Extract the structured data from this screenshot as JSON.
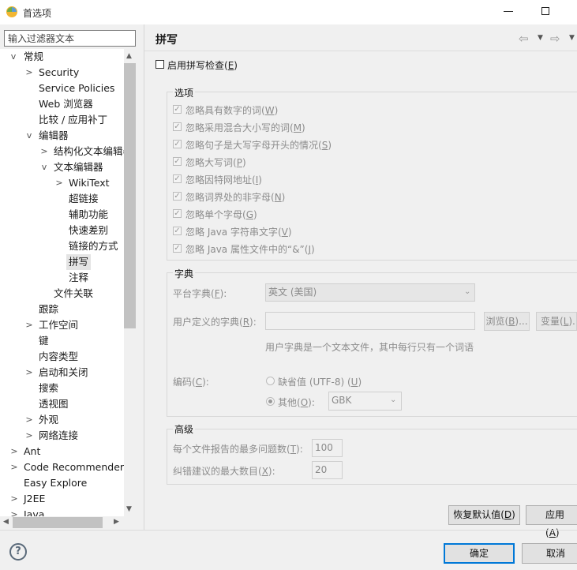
{
  "window": {
    "title": "首选项"
  },
  "filter": {
    "placeholder": "输入过滤器文本"
  },
  "tree": [
    {
      "label": "常规",
      "twisty": "v"
    },
    {
      "label": "Security",
      "twisty": ">"
    },
    {
      "label": "Service Policies",
      "twisty": ""
    },
    {
      "label": "Web 浏览器",
      "twisty": ""
    },
    {
      "label": "比较 / 应用补丁",
      "twisty": ""
    },
    {
      "label": "编辑器",
      "twisty": "v"
    },
    {
      "label": "结构化文本编辑器",
      "twisty": ">"
    },
    {
      "label": "文本编辑器",
      "twisty": "v"
    },
    {
      "label": "WikiText",
      "twisty": ">"
    },
    {
      "label": "超链接",
      "twisty": ""
    },
    {
      "label": "辅助功能",
      "twisty": ""
    },
    {
      "label": "快速差别",
      "twisty": ""
    },
    {
      "label": "链接的方式",
      "twisty": ""
    },
    {
      "label": "拼写",
      "twisty": ""
    },
    {
      "label": "注释",
      "twisty": ""
    },
    {
      "label": "文件关联",
      "twisty": ""
    },
    {
      "label": "跟踪",
      "twisty": ""
    },
    {
      "label": "工作空间",
      "twisty": ">"
    },
    {
      "label": "键",
      "twisty": ""
    },
    {
      "label": "内容类型",
      "twisty": ""
    },
    {
      "label": "启动和关闭",
      "twisty": ">"
    },
    {
      "label": "搜索",
      "twisty": ""
    },
    {
      "label": "透视图",
      "twisty": ""
    },
    {
      "label": "外观",
      "twisty": ">"
    },
    {
      "label": "网络连接",
      "twisty": ">"
    },
    {
      "label": "Ant",
      "twisty": ">"
    },
    {
      "label": "Code Recommenders",
      "twisty": ">"
    },
    {
      "label": "Easy Explore",
      "twisty": ""
    },
    {
      "label": "J2EE",
      "twisty": ">"
    },
    {
      "label": "Java",
      "twisty": ">"
    }
  ],
  "page": {
    "title": "拼写",
    "enable_spell": {
      "text": "启用拼写检查(",
      "key": "E",
      "end": ")"
    }
  },
  "options": {
    "title": "选项",
    "items": [
      {
        "text": "忽略具有数字的词(",
        "key": "W",
        "end": ")"
      },
      {
        "text": "忽略采用混合大小写的词(",
        "key": "M",
        "end": ")"
      },
      {
        "text": "忽略句子是大写字母开头的情况(",
        "key": "S",
        "end": ")"
      },
      {
        "text": "忽略大写词(",
        "key": "P",
        "end": ")"
      },
      {
        "text": "忽略因特网地址(",
        "key": "I",
        "end": ")"
      },
      {
        "text": "忽略词界处的非字母(",
        "key": "N",
        "end": ")"
      },
      {
        "text": "忽略单个字母(",
        "key": "G",
        "end": ")"
      },
      {
        "text": "忽略 Java 字符串文字(",
        "key": "V",
        "end": ")"
      },
      {
        "text": "忽略 Java 属性文件中的“&”(",
        "key": "J",
        "end": ")"
      }
    ]
  },
  "dictionary": {
    "title": "字典",
    "platform_label": {
      "text": "平台字典(",
      "key": "F",
      "end": "):"
    },
    "platform_value": "英文 (美国)",
    "user_label": {
      "text": "用户定义的字典(",
      "key": "R",
      "end": "):"
    },
    "user_value": "",
    "browse": {
      "text": "浏览(",
      "key": "B",
      "end": ")..."
    },
    "variables": {
      "text": "变量(",
      "key": "L",
      "end": ")..."
    },
    "hint": "用户字典是一个文本文件，其中每行只有一个词语",
    "encoding_label": {
      "text": "编码(",
      "key": "C",
      "end": "):"
    },
    "default": {
      "text": "缺省值 (UTF-8) (",
      "key": "U",
      "end": ")"
    },
    "other": {
      "text": "其他(",
      "key": "O",
      "end": "):"
    },
    "other_value": "GBK"
  },
  "advanced": {
    "title": "高级",
    "max_problems": {
      "text": "每个文件报告的最多问题数(",
      "key": "T",
      "end": "):",
      "value": "100"
    },
    "max_suggestions": {
      "text": "纠错建议的最大数目(",
      "key": "X",
      "end": "):",
      "value": "20"
    }
  },
  "buttons": {
    "restore": {
      "text": "恢复默认值(",
      "key": "D",
      "end": ")"
    },
    "apply": {
      "text": "应用(",
      "key": "A",
      "end": ")"
    },
    "ok": "确定",
    "cancel": "取消"
  },
  "colors": {
    "accent": "#0078d7",
    "selection": "#e4e4e4",
    "disabled": "#8c8c8c"
  }
}
